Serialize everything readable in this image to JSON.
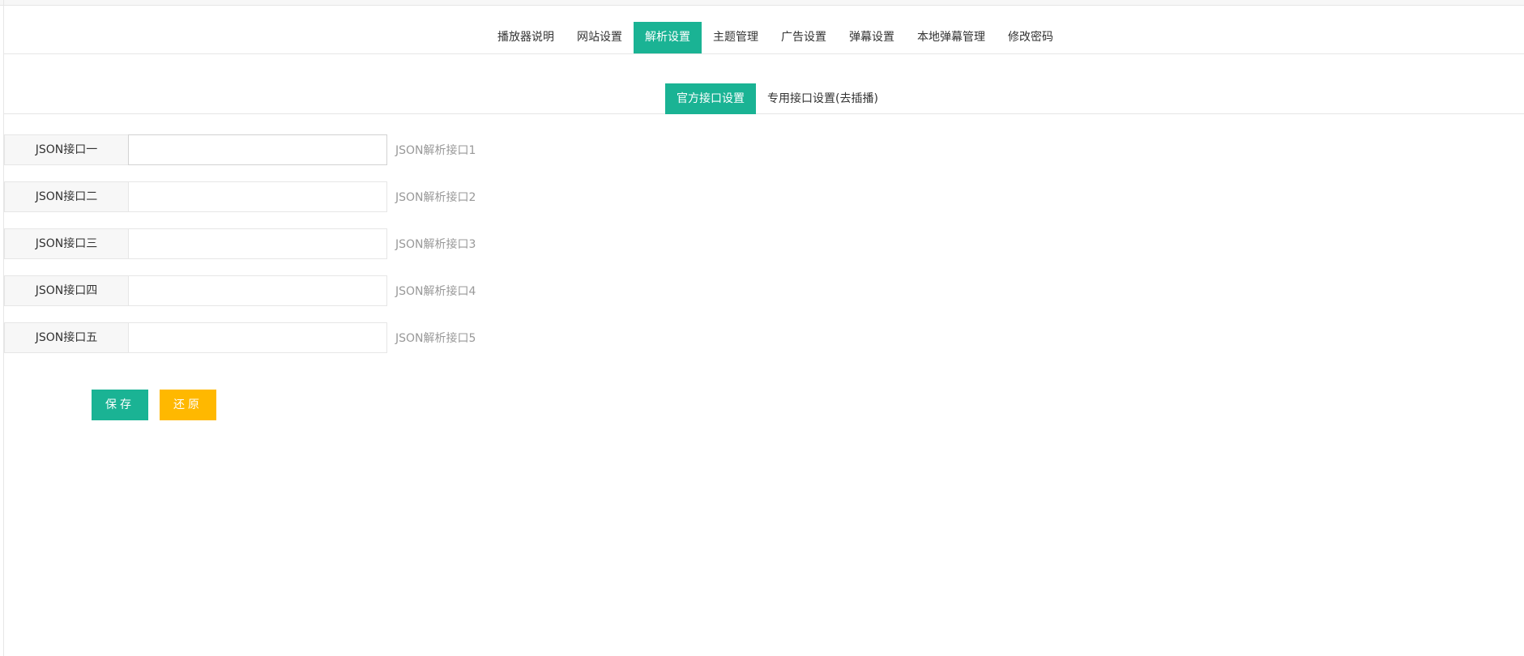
{
  "main_tabs": [
    {
      "label": "播放器说明",
      "active": false
    },
    {
      "label": "网站设置",
      "active": false
    },
    {
      "label": "解析设置",
      "active": true
    },
    {
      "label": "主题管理",
      "active": false
    },
    {
      "label": "广告设置",
      "active": false
    },
    {
      "label": "弹幕设置",
      "active": false
    },
    {
      "label": "本地弹幕管理",
      "active": false
    },
    {
      "label": "修改密码",
      "active": false
    }
  ],
  "sub_tabs": [
    {
      "label": "官方接口设置",
      "active": true
    },
    {
      "label": "专用接口设置(去插播)",
      "active": false
    }
  ],
  "form": {
    "rows": [
      {
        "label": "JSON接口一",
        "value": "",
        "aux": "JSON解析接口1"
      },
      {
        "label": "JSON接口二",
        "value": "",
        "aux": "JSON解析接口2"
      },
      {
        "label": "JSON接口三",
        "value": "",
        "aux": "JSON解析接口3"
      },
      {
        "label": "JSON接口四",
        "value": "",
        "aux": "JSON解析接口4"
      },
      {
        "label": "JSON接口五",
        "value": "",
        "aux": "JSON解析接口5"
      }
    ]
  },
  "actions": {
    "save_label": "保存",
    "reset_label": "还原"
  },
  "colors": {
    "accent": "#1ab394",
    "warning": "#ffb800"
  }
}
